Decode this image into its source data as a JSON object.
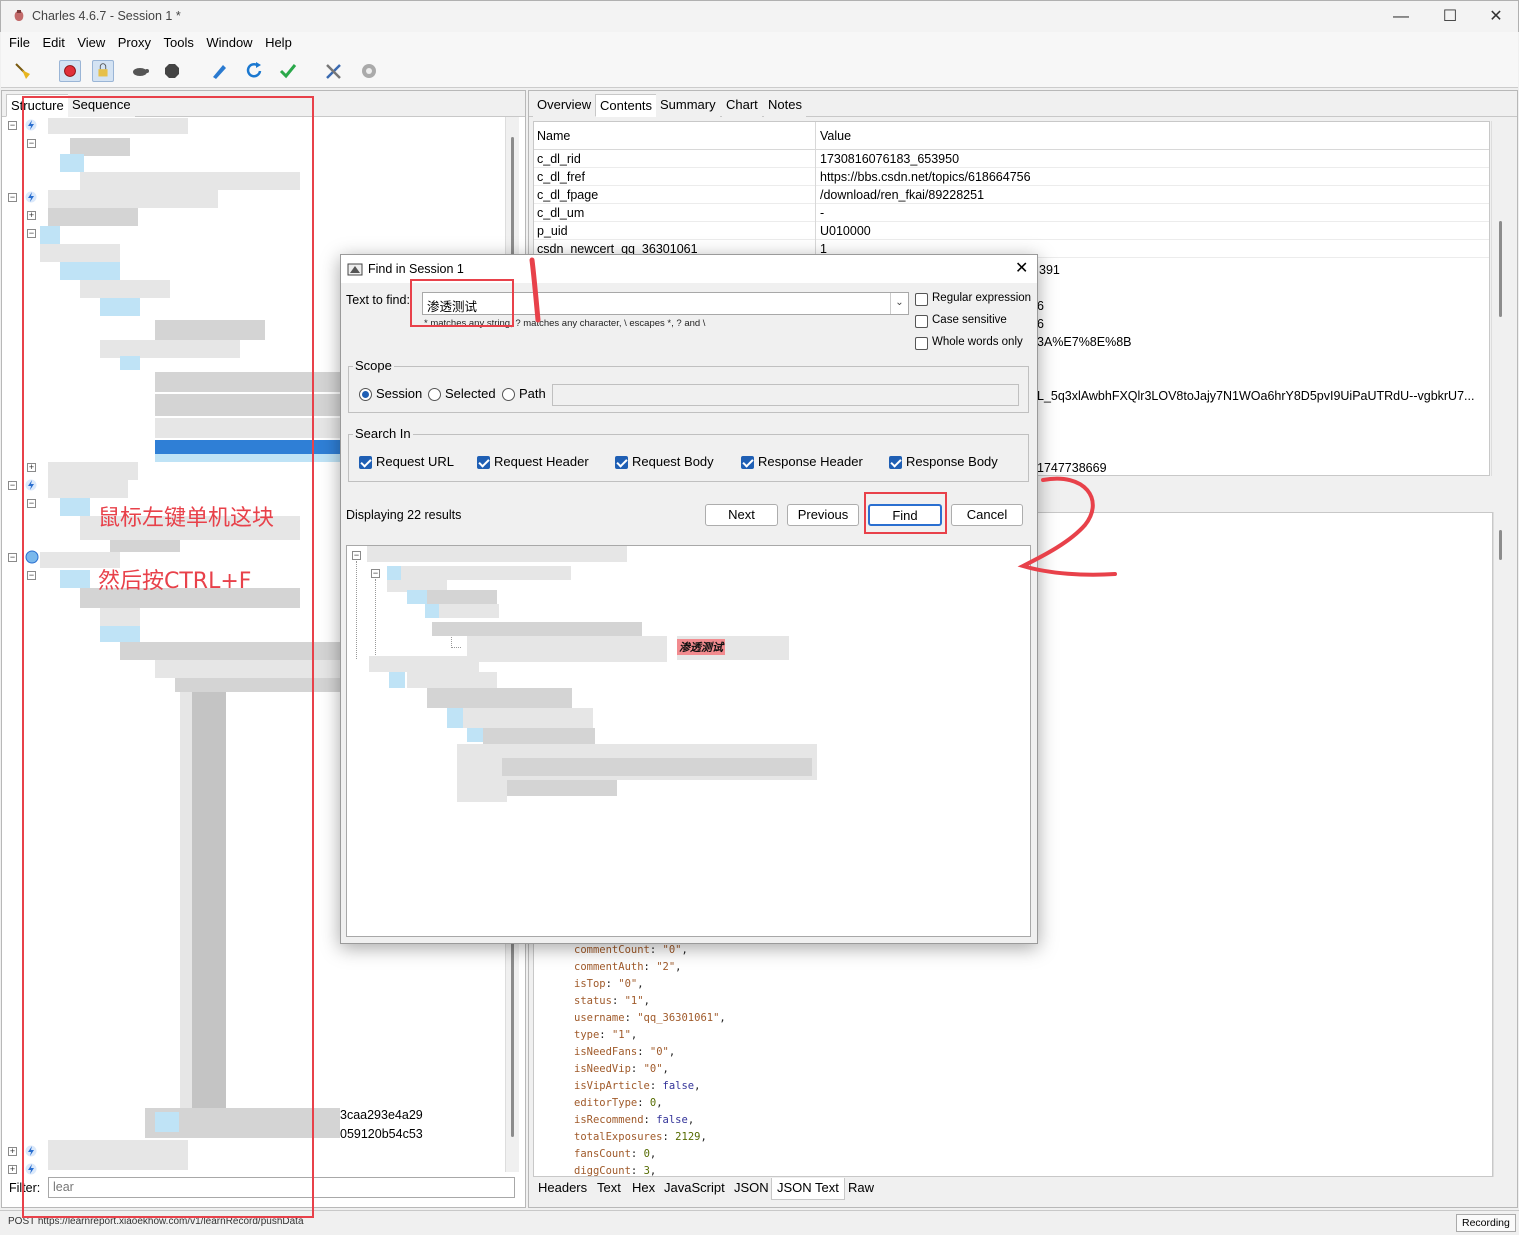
{
  "window": {
    "title": "Charles 4.6.7 - Session 1 *"
  },
  "menu": [
    "File",
    "Edit",
    "View",
    "Proxy",
    "Tools",
    "Window",
    "Help"
  ],
  "toolbar_icons": [
    "broom-icon",
    "record-icon",
    "throttle-lock-icon",
    "turtle-icon",
    "stop-hexagon-icon",
    "pen-icon",
    "refresh-icon",
    "check-icon",
    "tools-icon",
    "settings-gear-icon"
  ],
  "left": {
    "tabs": [
      "Structure",
      "Sequence"
    ],
    "visible_fragments": [
      "3caa293e4a29",
      "059120b54c53"
    ],
    "filter_label": "Filter:",
    "filter_value": "lear"
  },
  "right": {
    "tabs": [
      "Overview",
      "Contents",
      "Summary",
      "Chart",
      "Notes"
    ],
    "active_tab": "Contents",
    "table": {
      "headers": [
        "Name",
        "Value"
      ],
      "rows": [
        {
          "name": "c_dl_rid",
          "value": "1730816076183_653950"
        },
        {
          "name": "c_dl_fref",
          "value": "https://bbs.csdn.net/topics/618664756"
        },
        {
          "name": "c_dl_fpage",
          "value": "/download/ren_fkai/89228251"
        },
        {
          "name": "c_dl_um",
          "value": "-"
        },
        {
          "name": "p_uid",
          "value": "U010000"
        },
        {
          "name": "csdn_newcert_qq_36301061",
          "value": "1"
        }
      ],
      "partial_values": [
        "391",
        "6",
        "6",
        "3A%E7%8E%8B",
        "L_5q3xlAwbhFXQlr3LOV8toJajy7N1WOa6hrY8D5pvI9UiPaUTRdU--vgbkrU7...",
        "1747738669"
      ]
    },
    "json_lines": [
      {
        "k": "commentCount",
        "v": "\"0\"",
        "t": "s"
      },
      {
        "k": "commentAuth",
        "v": "\"2\"",
        "t": "s"
      },
      {
        "k": "isTop",
        "v": "\"0\"",
        "t": "s"
      },
      {
        "k": "status",
        "v": "\"1\"",
        "t": "s"
      },
      {
        "k": "username",
        "v": "\"qq_36301061\"",
        "t": "s"
      },
      {
        "k": "type",
        "v": "\"1\"",
        "t": "s"
      },
      {
        "k": "isNeedFans",
        "v": "\"0\"",
        "t": "s"
      },
      {
        "k": "isNeedVip",
        "v": "\"0\"",
        "t": "s"
      },
      {
        "k": "isVipArticle",
        "v": "false",
        "t": "b"
      },
      {
        "k": "editorType",
        "v": "0",
        "t": "n"
      },
      {
        "k": "isRecommend",
        "v": "false",
        "t": "b"
      },
      {
        "k": "totalExposures",
        "v": "2129",
        "t": "n"
      },
      {
        "k": "fansCount",
        "v": "0",
        "t": "n"
      },
      {
        "k": "diggCount",
        "v": "3",
        "t": "n"
      }
    ],
    "bottom_tabs": [
      "Headers",
      "Text",
      "Hex",
      "JavaScript",
      "JSON",
      "JSON Text",
      "Raw"
    ],
    "bottom_active_tab": "JSON Text"
  },
  "status": {
    "text": "POST https://learnreport.xiaoekhow.com/v1/learnRecord/pushData",
    "recording": "Recording"
  },
  "dialog": {
    "title": "Find in Session 1",
    "text_to_find_label": "Text to find:",
    "text_to_find_value": "渗透测试",
    "hint": "* matches any string, ? matches any character, \\ escapes *, ? and \\",
    "options": [
      {
        "label": "Regular expression",
        "checked": false
      },
      {
        "label": "Case sensitive",
        "checked": false
      },
      {
        "label": "Whole words only",
        "checked": false
      }
    ],
    "scope_title": "Scope",
    "scope_options": [
      {
        "label": "Session",
        "selected": true
      },
      {
        "label": "Selected",
        "selected": false
      },
      {
        "label": "Path",
        "selected": false
      }
    ],
    "search_in_title": "Search In",
    "search_in": [
      {
        "label": "Request URL",
        "checked": true
      },
      {
        "label": "Request Header",
        "checked": true
      },
      {
        "label": "Request Body",
        "checked": true
      },
      {
        "label": "Response Header",
        "checked": true
      },
      {
        "label": "Response Body",
        "checked": true
      }
    ],
    "results_label": "Displaying 22 results",
    "buttons": {
      "next": "Next",
      "previous": "Previous",
      "find": "Find",
      "cancel": "Cancel"
    },
    "highlight_match": "渗透测试"
  },
  "annotations": {
    "line1": "鼠标左键单机这块",
    "line2": "然后按CTRL+F",
    "colors": {
      "annotation_red": "#e8414a"
    }
  }
}
